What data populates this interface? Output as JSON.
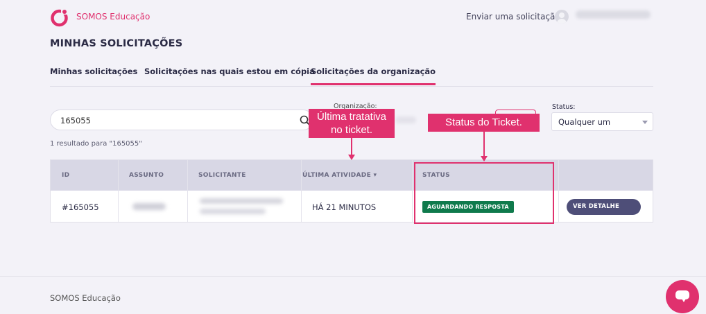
{
  "header": {
    "brand": "SOMOS Educação",
    "send_request": "Enviar uma solicitação",
    "logo_icon": "somos-logo-icon",
    "avatar_icon": "user-avatar-icon",
    "accent_color": "#e0316e"
  },
  "page": {
    "title": "MINHAS SOLICITAÇÕES"
  },
  "tabs": [
    {
      "label": "Minhas solicitações",
      "active": false
    },
    {
      "label": "Solicitações nas quais estou em cópia",
      "active": false
    },
    {
      "label": "Solicitações da organização",
      "active": true
    }
  ],
  "search": {
    "value": "165055",
    "icon": "search-icon",
    "result_count": "1 resultado para \"165055\""
  },
  "filters": {
    "organization_label": "Organização:",
    "status_label": "Status:",
    "status_value": "Qualquer um"
  },
  "table": {
    "columns": [
      "ID",
      "ASSUNTO",
      "SOLICITANTE",
      "ÚLTIMA ATIVIDADE ▾",
      "STATUS"
    ],
    "rows": [
      {
        "id": "#165055",
        "last_activity": "HÁ 21 MINUTOS",
        "status": "AGUARDANDO RESPOSTA",
        "status_color": "#0f7a4c",
        "action": "VER DETALHE"
      }
    ]
  },
  "annotations": {
    "callout_last_activity": [
      "Última tratativa",
      "no ticket."
    ],
    "callout_status": "Status do Ticket."
  },
  "footer": {
    "text": "SOMOS Educação",
    "chat_icon": "chat-bubble-icon"
  }
}
